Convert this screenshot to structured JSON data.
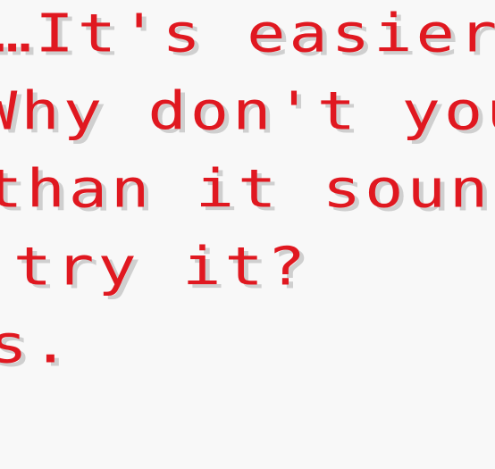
{
  "dialog": {
    "lines": [
      "…It's easier t",
      "Why don't you",
      "than it sound",
      "u try it?",
      "ls."
    ]
  },
  "colors": {
    "background": "#f8f8f8",
    "text": "#e01820",
    "shadow": "#cfcfcf"
  }
}
